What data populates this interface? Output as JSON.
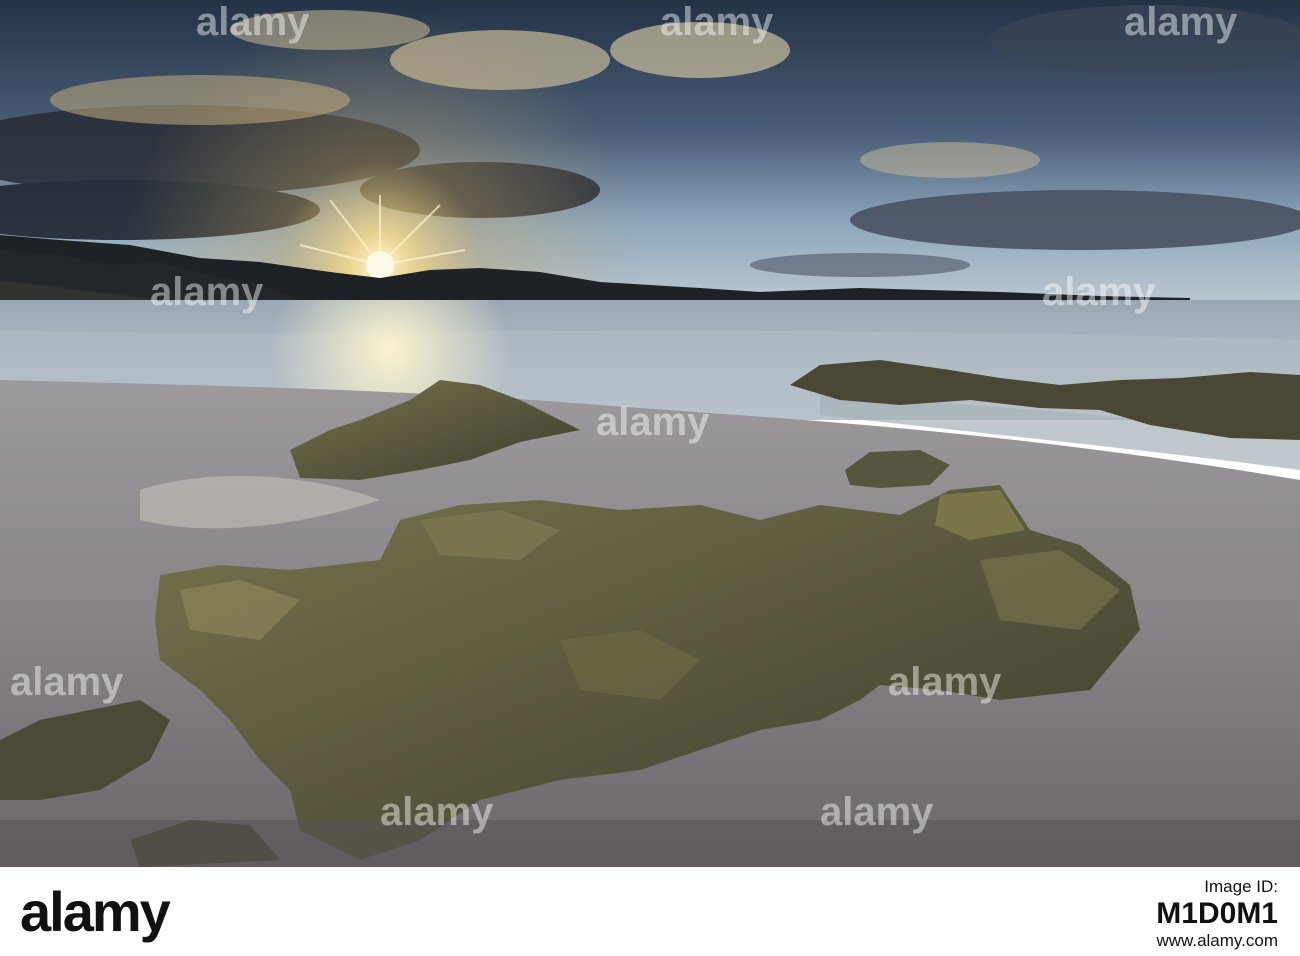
{
  "watermark": {
    "text": "alamy"
  },
  "footer": {
    "brand": "alamy",
    "image_id_label": "Image ID:",
    "image_id": "M1D0M1",
    "url": "www.alamy.com"
  },
  "colors": {
    "sky_dark": "#2f3d52",
    "sky_light": "#9fb6c9",
    "sun": "#fff4c2",
    "sand": "#8a8689",
    "rock": "#5c5a3f"
  }
}
